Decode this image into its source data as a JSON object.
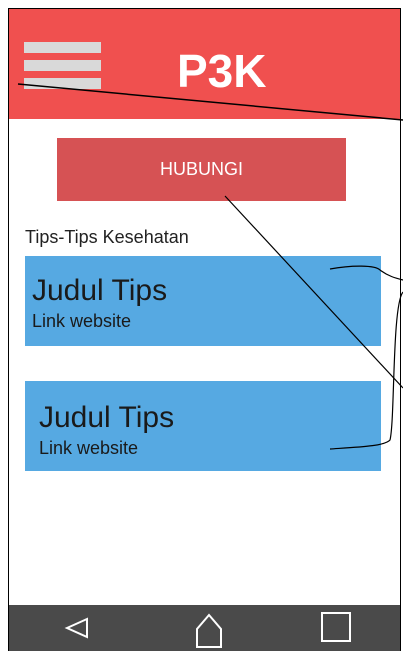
{
  "app": {
    "title": "P3K"
  },
  "actions": {
    "hubungi_label": "HUBUNGI"
  },
  "section": {
    "title": "Tips-Tips Kesehatan"
  },
  "tips": [
    {
      "title": "Judul Tips",
      "link": "Link website"
    },
    {
      "title": "Judul Tips",
      "link": "Link website"
    }
  ],
  "icons": {
    "menu": "hamburger-icon",
    "nav_back": "back-triangle-icon",
    "nav_home": "home-icon",
    "nav_recents": "recents-square-icon"
  },
  "colors": {
    "header": "#f0504f",
    "button": "#d65254",
    "card": "#56a9e2",
    "navbar": "#4a4a4a"
  }
}
